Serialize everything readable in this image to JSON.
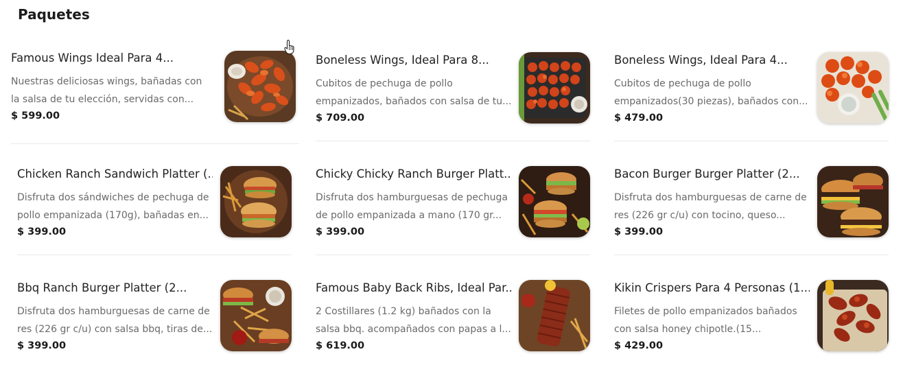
{
  "section": {
    "title": "Paquetes"
  },
  "products": [
    {
      "name": "Famous Wings Ideal Para 4...",
      "desc_line1": "Nuestras deliciosas wings, bañadas con",
      "desc_line2": "la salsa de tu elección, servidas con...",
      "price": "$ 599.00",
      "image": "wings-image"
    },
    {
      "name": "Boneless Wings, Ideal Para 8...",
      "desc_line1": "Cubitos de pechuga de pollo",
      "desc_line2": "empanizados, bañados con salsa de tu...",
      "price": "$ 709.00",
      "image": "boneless-tray-image"
    },
    {
      "name": "Boneless Wings, Ideal Para 4...",
      "desc_line1": "Cubitos de pechuga de pollo",
      "desc_line2": "empanizados(30 piezas), bañados con...",
      "price": "$ 479.00",
      "image": "boneless-plate-image"
    },
    {
      "name": "Chicken Ranch Sandwich Platter (...",
      "desc_line1": "Disfruta dos sándwiches de pechuga de",
      "desc_line2": "pollo empanizada (170g), bañadas en...",
      "price": "$ 399.00",
      "image": "chicken-sandwich-image"
    },
    {
      "name": "Chicky Chicky Ranch Burger Platt...",
      "desc_line1": "Disfruta dos hamburguesas de pechuga",
      "desc_line2": "de pollo empanizada a mano (170 gr...",
      "price": "$ 399.00",
      "image": "chicken-burger-image"
    },
    {
      "name": "Bacon Burger Burger Platter (2...",
      "desc_line1": "Disfruta dos hamburguesas de carne de",
      "desc_line2": "res (226 gr c/u) con tocino, queso...",
      "price": "$ 399.00",
      "image": "bacon-burger-image"
    },
    {
      "name": "Bbq Ranch Burger Platter (2...",
      "desc_line1": "Disfruta dos hamburguesas de carne de",
      "desc_line2": "res (226 gr c/u) con salsa bbq, tiras de...",
      "price": "$ 399.00",
      "image": "bbq-burger-image"
    },
    {
      "name": "Famous Baby Back Ribs, Ideal Par...",
      "desc_line1": "2 Costillares (1.2 kg) bañados con la",
      "desc_line2": "salsa bbq. acompañados con papas a l...",
      "price": "$ 619.00",
      "image": "ribs-image"
    },
    {
      "name": "Kikin Crispers Para 4 Personas (1...",
      "desc_line1": "Filetes de pollo empanizados bañados",
      "desc_line2": "con salsa honey chipotle.(15...",
      "price": "$ 429.00",
      "image": "crispers-image"
    }
  ]
}
